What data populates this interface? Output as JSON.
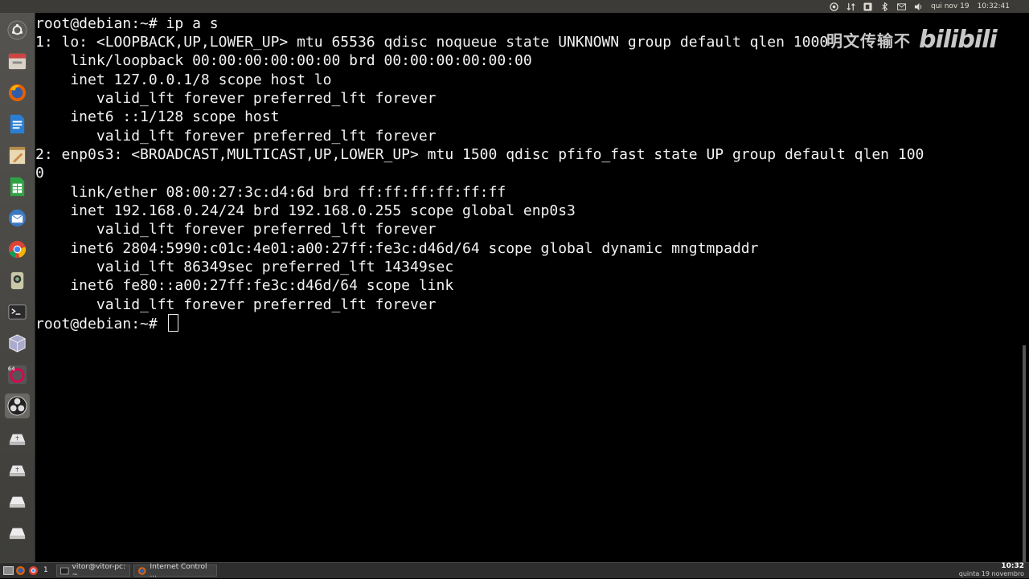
{
  "panel": {
    "date": "qui nov 19",
    "time": "10:32:41",
    "indicators": [
      "chrome-icon",
      "network-arrows-icon",
      "keyboard-icon",
      "bluetooth-icon",
      "mail-icon",
      "volume-icon"
    ]
  },
  "launcher": {
    "items": [
      "ubuntu-dash-icon",
      "file-manager-icon",
      "firefox-icon",
      "writer-document-icon",
      "text-editor-icon",
      "calc-spreadsheet-icon",
      "thunderbird-mail-icon",
      "chrome-icon",
      "camera-icon",
      "terminal-icon",
      "virtualbox-icon",
      "debian-icon",
      "obs-icon",
      "usb-drive-icon",
      "usb-drive-icon-2",
      "hard-drive-icon",
      "hard-drive-icon-2"
    ]
  },
  "terminal": {
    "lines": [
      "root@debian:~# ip a s",
      "1: lo: <LOOPBACK,UP,LOWER_UP> mtu 65536 qdisc noqueue state UNKNOWN group default qlen 1000",
      "    link/loopback 00:00:00:00:00:00 brd 00:00:00:00:00:00",
      "    inet 127.0.0.1/8 scope host lo",
      "       valid_lft forever preferred_lft forever",
      "    inet6 ::1/128 scope host",
      "       valid_lft forever preferred_lft forever",
      "2: enp0s3: <BROADCAST,MULTICAST,UP,LOWER_UP> mtu 1500 qdisc pfifo_fast state UP group default qlen 100",
      "0",
      "    link/ether 08:00:27:3c:d4:6d brd ff:ff:ff:ff:ff:ff",
      "    inet 192.168.0.24/24 brd 192.168.0.255 scope global enp0s3",
      "       valid_lft forever preferred_lft forever",
      "    inet6 2804:5990:c01c:4e01:a00:27ff:fe3c:d46d/64 scope global dynamic mngtmpaddr",
      "       valid_lft 86349sec preferred_lft 14349sec",
      "    inet6 fe80::a00:27ff:fe3c:d46d/64 scope link",
      "       valid_lft forever preferred_lft forever"
    ],
    "prompt": "root@debian:~# "
  },
  "watermark": {
    "text": "明文传输不",
    "logo": "bilibili"
  },
  "taskbar": {
    "workspace": "1",
    "windows": [
      {
        "title": "vitor@vitor-pc: ~",
        "icon": "terminal-icon"
      },
      {
        "title": "Internet Control ...",
        "icon": "firefox-icon"
      }
    ],
    "clock_time": "10:32",
    "clock_date": "quinta 19 novembro"
  }
}
